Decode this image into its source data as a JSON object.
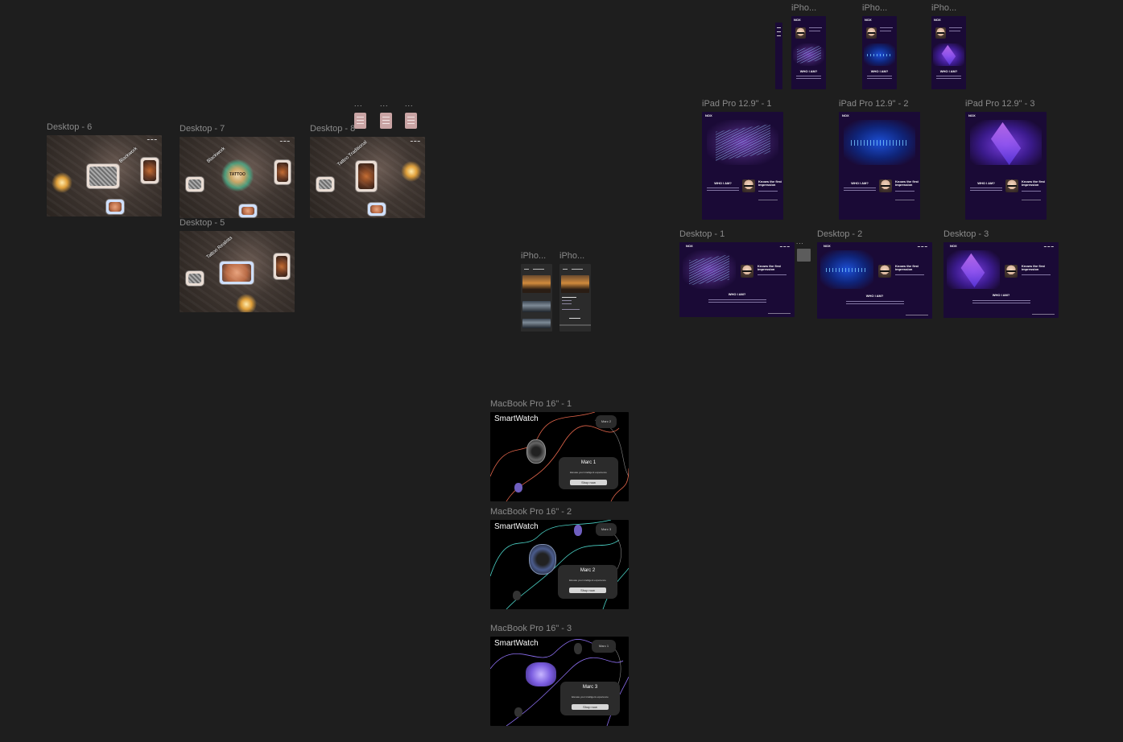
{
  "canvas": {
    "background": "#1e1e1e",
    "frames": [
      {
        "id": "desktop-6",
        "label": "Desktop - 6",
        "headline": "Blackwork"
      },
      {
        "id": "desktop-7",
        "label": "Desktop - 7",
        "headline": "Blackwork",
        "logo_text": "TATTOO"
      },
      {
        "id": "desktop-8",
        "label": "Desktop - 8",
        "headline": "Tattoo Traditional"
      },
      {
        "id": "desktop-5",
        "label": "Desktop - 5",
        "headline": "Tattoo Realista"
      },
      {
        "id": "iphone-a",
        "label": "iPho..."
      },
      {
        "id": "iphone-b",
        "label": "iPho..."
      },
      {
        "id": "iphone-c",
        "label": "iPho..."
      },
      {
        "id": "ipad-1",
        "label": "iPad Pro 12.9\" - 1"
      },
      {
        "id": "ipad-2",
        "label": "iPad Pro 12.9\" - 2"
      },
      {
        "id": "ipad-3",
        "label": "iPad Pro 12.9\" - 3"
      },
      {
        "id": "desktop-1",
        "label": "Desktop - 1"
      },
      {
        "id": "desktop-2",
        "label": "Desktop - 2"
      },
      {
        "id": "desktop-3",
        "label": "Desktop - 3"
      },
      {
        "id": "iphone-d",
        "label": "iPho..."
      },
      {
        "id": "iphone-e",
        "label": "iPho..."
      },
      {
        "id": "macbook-1",
        "label": "MacBook Pro 16\" - 1"
      },
      {
        "id": "macbook-2",
        "label": "MacBook Pro 16\" - 2"
      },
      {
        "id": "macbook-3",
        "label": "MacBook Pro 16\" - 3"
      }
    ],
    "small_dots": "...",
    "nox": {
      "brand": "NOX",
      "who_heading": "WHO I AM?",
      "knows_line1": "Knows the first",
      "knows_line2": "impression"
    },
    "smartwatch": {
      "title": "SmartWatch",
      "shop_label": "Shop now",
      "desc": "Elevate your intelligent experience",
      "pages": [
        {
          "product": "Marc 1",
          "pill": "Marc 2"
        },
        {
          "product": "Marc 2",
          "pill": "Marc 3"
        },
        {
          "product": "Marc 3",
          "pill": "Marc 1"
        }
      ]
    },
    "colors": {
      "nox_purple": "#1a0a36",
      "tattoo_brown": "#3f3631",
      "smartwatch_black": "#000000",
      "label_grey": "#8a8a8a"
    }
  }
}
